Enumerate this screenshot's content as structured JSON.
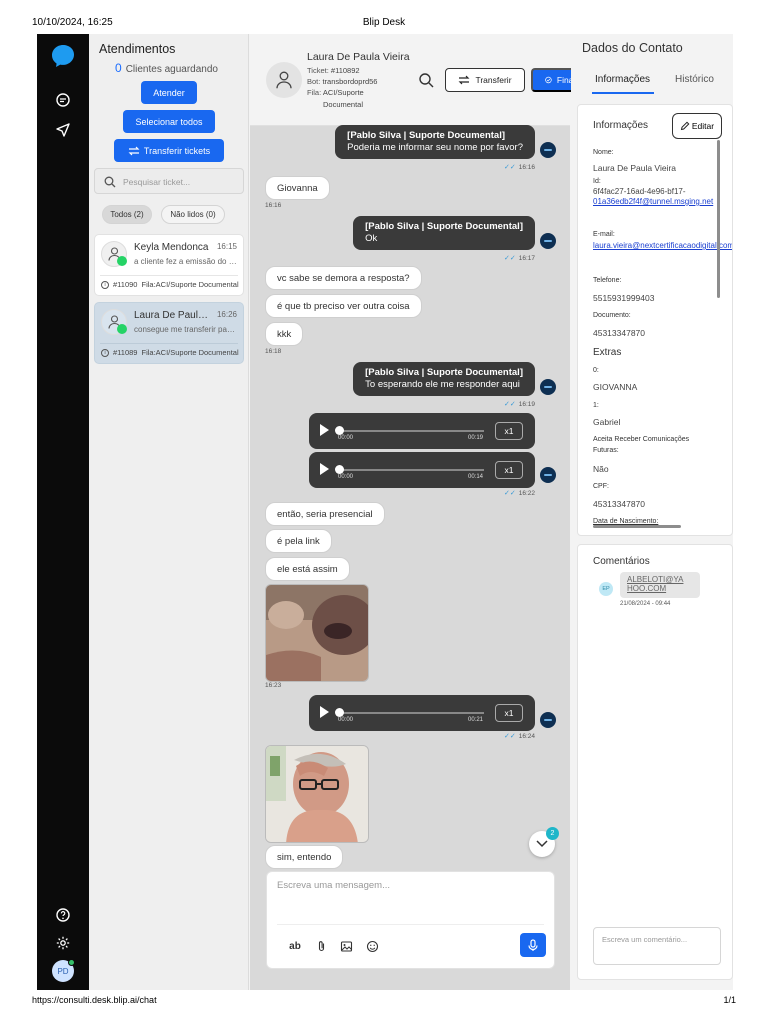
{
  "print": {
    "date": "10/10/2024, 16:25",
    "title": "Blip Desk",
    "url": "https://consulti.desk.blip.ai/chat",
    "page": "1/1"
  },
  "rail": {
    "avatar_initials": "PD",
    "icons": [
      "blip-logo-icon",
      "chat-icon",
      "send-icon",
      "help-icon",
      "settings-icon"
    ]
  },
  "tickets": {
    "title": "Atendimentos",
    "waiting_count": "0",
    "waiting_label": "Clientes aguardando",
    "btn_attend": "Atender",
    "btn_select_all": "Selecionar todos",
    "btn_transfer": "Transferir tickets",
    "search_placeholder": "Pesquisar ticket...",
    "filter_all": "Todos (2)",
    "filter_unread": "Não lidos (0)",
    "items": [
      {
        "name": "Keyla Mendonca",
        "time": "16:15",
        "preview": "a cliente fez a emissão do certificado",
        "id": "#11090",
        "queue": "Fila:ACI/Suporte Documental"
      },
      {
        "name": "Laura De Paula Vieira",
        "time": "16:26",
        "preview": "consegue me transferir para o atendente",
        "id": "#11089",
        "queue": "Fila:ACI/Suporte Documental"
      }
    ]
  },
  "chat": {
    "contact_name": "Laura De Paula Vieira",
    "ticket_label": "Ticket:",
    "ticket_value": "#110892",
    "bot_label": "Bot:",
    "bot_value": "transbordoprd56",
    "queue_label": "Fila:",
    "queue_value_1": "ACI/Suporte",
    "queue_value_2": "Documental",
    "btn_transfer": "Transferir",
    "btn_finish": "Finalizar",
    "messages": {
      "m1_sender": "[Pablo Silva | Suporte Documental]",
      "m1_text": "Poderia me informar seu nome por favor?",
      "m1_time": "16:16",
      "m2_text": "Giovanna",
      "m2_time": "16:16",
      "m3_sender": "[Pablo Silva | Suporte Documental]",
      "m3_text": "Ok",
      "m3_time": "16:17",
      "m4_text": "vc sabe se demora a resposta?",
      "m5_text": "é que tb preciso ver outra coisa",
      "m6_text": "kkk",
      "m6_time": "16:18",
      "m7_sender": "[Pablo Silva | Suporte Documental]",
      "m7_text": "To esperando ele me responder aqui",
      "m7_time": "16:19",
      "a1_start": "00:00",
      "a1_end": "00:19",
      "a1_speed": "x1",
      "a2_start": "00:00",
      "a2_end": "00:14",
      "a2_speed": "x1",
      "a2_time": "16:22",
      "m8_text": "então, seria presencial",
      "m9_text": "é pela link",
      "m10_text": "ele está assim",
      "photo1_time": "16:23",
      "a3_start": "00:00",
      "a3_end": "00:21",
      "a3_speed": "x1",
      "a3_time": "16:24",
      "m11_text": "sim, entendo"
    },
    "unread_badge": "2",
    "composer_placeholder": "Escreva uma mensagem...",
    "tool_text": "ab"
  },
  "contact": {
    "title": "Dados do Contato",
    "tab_info": "Informações",
    "tab_history": "Histórico",
    "info_title": "Informações",
    "btn_edit": "Editar",
    "name_label": "Nome:",
    "name_value": "Laura De Paula Vieira",
    "id_label": "Id:",
    "id_value": "6f4fac27-16ad-4e96-bf17-",
    "id_link": "01a36edb2f4f@tunnel.msging.net",
    "email_label": "E-mail:",
    "email_value": "laura.vieira@nextcertificacaodigital.com.br",
    "phone_label": "Telefone:",
    "phone_value": "5515931999403",
    "doc_label": "Documento:",
    "doc_value": "45313347870",
    "extras_title": "Extras",
    "extra0_label": "0:",
    "extra0_value": "GIOVANNA",
    "extra1_label": "1:",
    "extra1_value": "Gabriel",
    "consent_label_1": "Aceita Receber Comunicações",
    "consent_label_2": "Futuras:",
    "consent_value": "Não",
    "cpf_label": "CPF:",
    "cpf_value": "45313347870",
    "birth_label": "Data de Nascimento:",
    "comments_title": "Comentários",
    "comment_initials": "EP",
    "comment_text_1": "ALBELOTI@YA",
    "comment_text_2": "HOO.COM",
    "comment_date": "21/08/2024 - 09:44",
    "comment_placeholder": "Escreva um comentário..."
  },
  "colors": {
    "primary": "#1968f0",
    "rail": "#0b0b0b",
    "agent_bubble": "#3a3a3a",
    "chat_bg": "#d9d9d9"
  }
}
